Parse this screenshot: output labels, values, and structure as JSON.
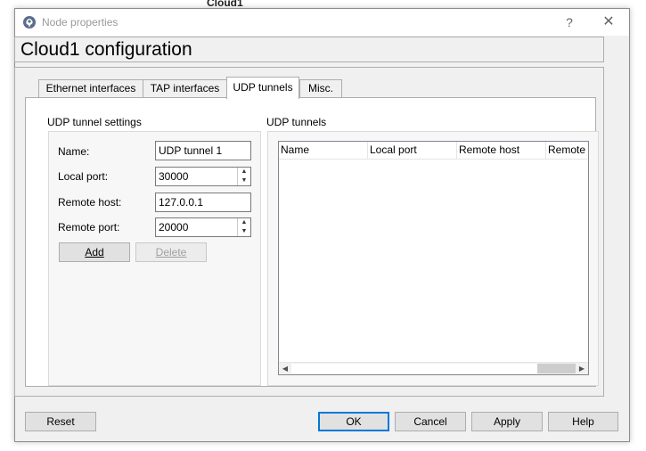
{
  "behind_window_title": "Cloud1",
  "window": {
    "title": "Node properties",
    "help_label": "?",
    "close_label": "✕"
  },
  "header": {
    "title": "Cloud1 configuration"
  },
  "tabs": [
    {
      "label": "Ethernet interfaces",
      "active": false
    },
    {
      "label": "TAP interfaces",
      "active": false
    },
    {
      "label": "UDP tunnels",
      "active": true
    },
    {
      "label": "Misc.",
      "active": false
    }
  ],
  "settings": {
    "group_label": "UDP tunnel settings",
    "name_label": "Name:",
    "name_value": "UDP tunnel 1",
    "local_port_label": "Local port:",
    "local_port_value": "30000",
    "remote_host_label": "Remote host:",
    "remote_host_value": "127.0.0.1",
    "remote_port_label": "Remote port:",
    "remote_port_value": "20000",
    "add_label": "Add",
    "delete_label": "Delete"
  },
  "tunnels": {
    "group_label": "UDP tunnels",
    "columns": [
      "Name",
      "Local port",
      "Remote host",
      "Remote"
    ],
    "rows": []
  },
  "footer": {
    "reset_label": "Reset",
    "ok_label": "OK",
    "cancel_label": "Cancel",
    "apply_label": "Apply",
    "help_label": "Help"
  },
  "icons": {
    "app": "gns3-app-icon",
    "spin_up": "spin-up-arrow-icon",
    "spin_down": "spin-down-arrow-icon",
    "scroll_left": "scroll-left-arrow-icon",
    "scroll_right": "scroll-right-arrow-icon"
  },
  "colors": {
    "accent": "#0078d7",
    "window_bg": "#f0f0f0",
    "button_bg": "#e1e1e1"
  }
}
